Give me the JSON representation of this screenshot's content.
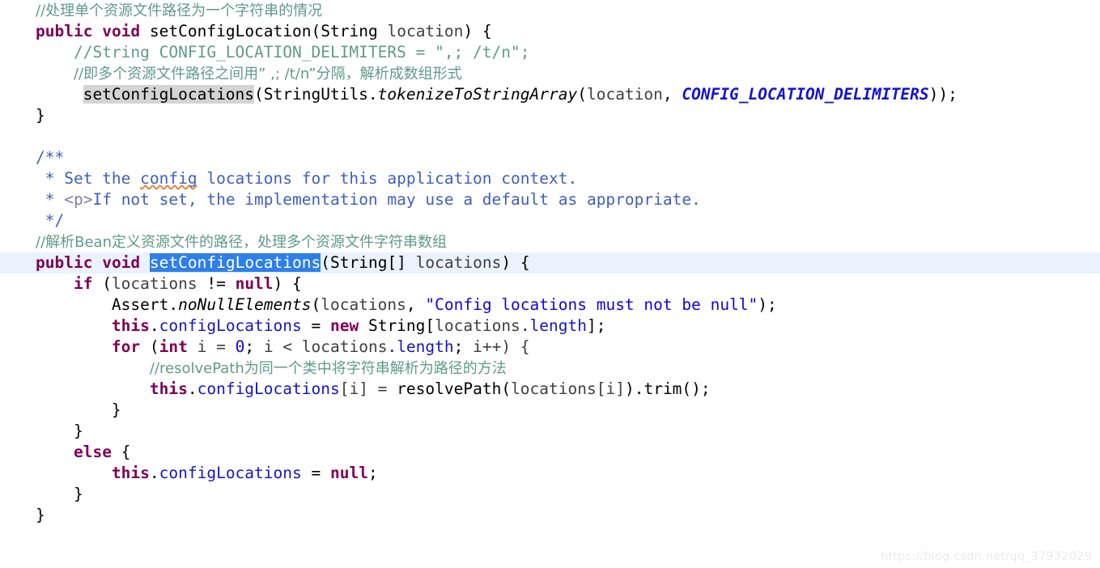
{
  "editor": {
    "language": "java",
    "background": "#ffffff",
    "current_line_background": "#e9f2fd",
    "selection_background": "#2f7fe8",
    "occurrence_background": "#d4d4d4",
    "colors": {
      "keyword": "#7f0055",
      "comment": "#5f9b8a",
      "javadoc": "#3f5fbf",
      "javadoc_tag": "#7f7f9f",
      "string": "#1500e0",
      "field": "#1414cc",
      "static_constant": "#1414cc",
      "static_method": "#000000",
      "plain": "#000000",
      "parameter": "#3f3f3f",
      "spellcheck_squiggle": "#e08030"
    }
  },
  "code": {
    "line01": {
      "comment": "//处理单个资源文件路径为一个字符串的情况"
    },
    "line02": {
      "kw_public": "public",
      "kw_void": "void",
      "method": "setConfigLocation",
      "open_paren": "(",
      "type_string": "String",
      "param": "location",
      "close_paren": ")",
      "brace": "{"
    },
    "line03": {
      "comment": "//String CONFIG_LOCATION_DELIMITERS = \",; /t/n\";"
    },
    "line04": {
      "comment": "//即多个资源文件路径之间用” ,; /t/n”分隔，解析成数组形式"
    },
    "line05": {
      "call_highlighted": "setConfigLocations",
      "open_paren": "(",
      "utils_class": "StringUtils.",
      "static_method": "tokenizeToStringArray",
      "open_paren2": "(",
      "arg1": "location",
      "comma": ", ",
      "constant": "CONFIG_LOCATION_DELIMITERS",
      "tail": "));"
    },
    "line06": {
      "brace": "}"
    },
    "line07": {
      "blank": ""
    },
    "line08": {
      "doc": "/**"
    },
    "line09": {
      "doc_before": " * Set the ",
      "doc_squiggle": "config",
      "doc_after": " locations for this application context."
    },
    "line10": {
      "doc_star": " * ",
      "doc_tag": "<p>",
      "doc_text": "If not set, the implementation may use a default as appropriate."
    },
    "line11": {
      "doc": " */"
    },
    "line12": {
      "comment": "//解析Bean定义资源文件的路径，处理多个资源文件字符串数组"
    },
    "line13": {
      "kw_public": "public",
      "kw_void": "void",
      "method_selected": "setConfigLocations",
      "open_paren": "(",
      "type_string": "String[]",
      "param": "locations",
      "close_paren": ")",
      "brace": "{"
    },
    "line14": {
      "kw_if": "if",
      "open_paren": " (",
      "param": "locations",
      "op": " != ",
      "kw_null": "null",
      "tail": ") {"
    },
    "line15": {
      "assert_class": "Assert.",
      "static_method": "noNullElements",
      "open_paren": "(",
      "param": "locations",
      "comma": ", ",
      "string": "\"Config locations must not be null\"",
      "tail": ");"
    },
    "line16": {
      "kw_this": "this",
      "dot": ".",
      "field": "configLocations",
      "op": " = ",
      "kw_new": "new",
      "type_string": " String[",
      "param": "locations",
      "field2": ".length",
      "tail": "];"
    },
    "line17": {
      "kw_for": "for",
      "open_paren": " (",
      "kw_int": "int",
      "var": " i = ",
      "num_zero": "0",
      "semi": "; ",
      "cond": "i < ",
      "param": "locations",
      "field": ".length",
      "semi2": "; ",
      "incr": "i++) {"
    },
    "line18": {
      "comment": "//resolvePath为同一个类中将字符串解析为路径的方法"
    },
    "line19": {
      "kw_this": "this",
      "dot": ".",
      "field": "configLocations",
      "index": "[i] = ",
      "method": "resolvePath",
      "open_paren": "(",
      "param": "locations",
      "index2": "[i]",
      "close_paren": ")",
      "trim": ".trim();"
    },
    "line20": {
      "brace": "}"
    },
    "line21": {
      "brace": "}"
    },
    "line22": {
      "kw_else": "else",
      "brace": " {"
    },
    "line23": {
      "kw_this": "this",
      "dot": ".",
      "field": "configLocations",
      "op": " = ",
      "kw_null": "null",
      "semi": ";"
    },
    "line24": {
      "brace": "}"
    },
    "line25": {
      "brace": "}"
    }
  },
  "watermark": {
    "text": "https://blog.csdn.net/qq_37932029"
  }
}
